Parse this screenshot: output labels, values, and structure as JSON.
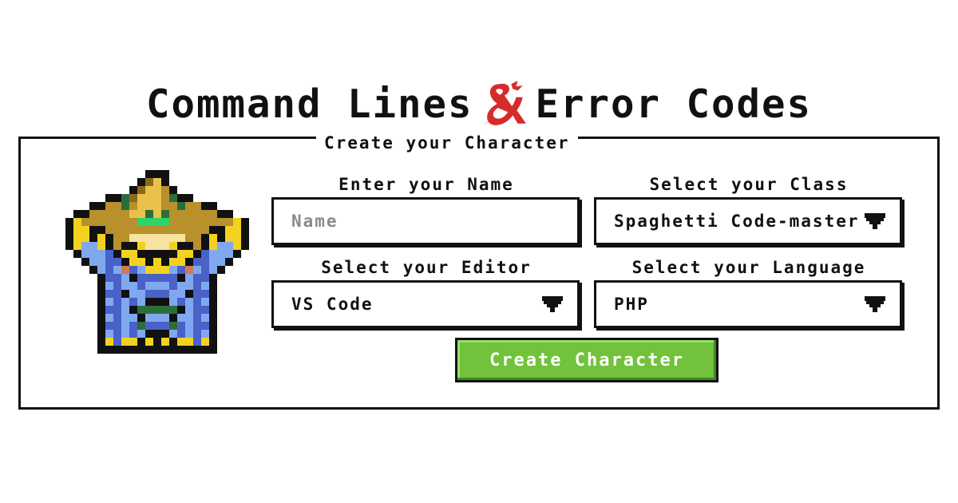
{
  "header": {
    "title_left": "Command Lines",
    "title_right": "Error Codes",
    "logo_icon": "dnd-ampersand-dragon-icon",
    "logo_color": "#d62b2b"
  },
  "form": {
    "legend": "Create your Character",
    "name": {
      "label": "Enter your Name",
      "value": "",
      "placeholder": "Name"
    },
    "class": {
      "label": "Select your Class",
      "selected": "Spaghetti Code-master"
    },
    "editor": {
      "label": "Select your Editor",
      "selected": "VS Code"
    },
    "language": {
      "label": "Select your Language",
      "selected": "PHP"
    },
    "submit_label": "Create Character",
    "submit_color": "#72c23c"
  },
  "avatar": {
    "icon": "pixel-wizard-icon"
  }
}
